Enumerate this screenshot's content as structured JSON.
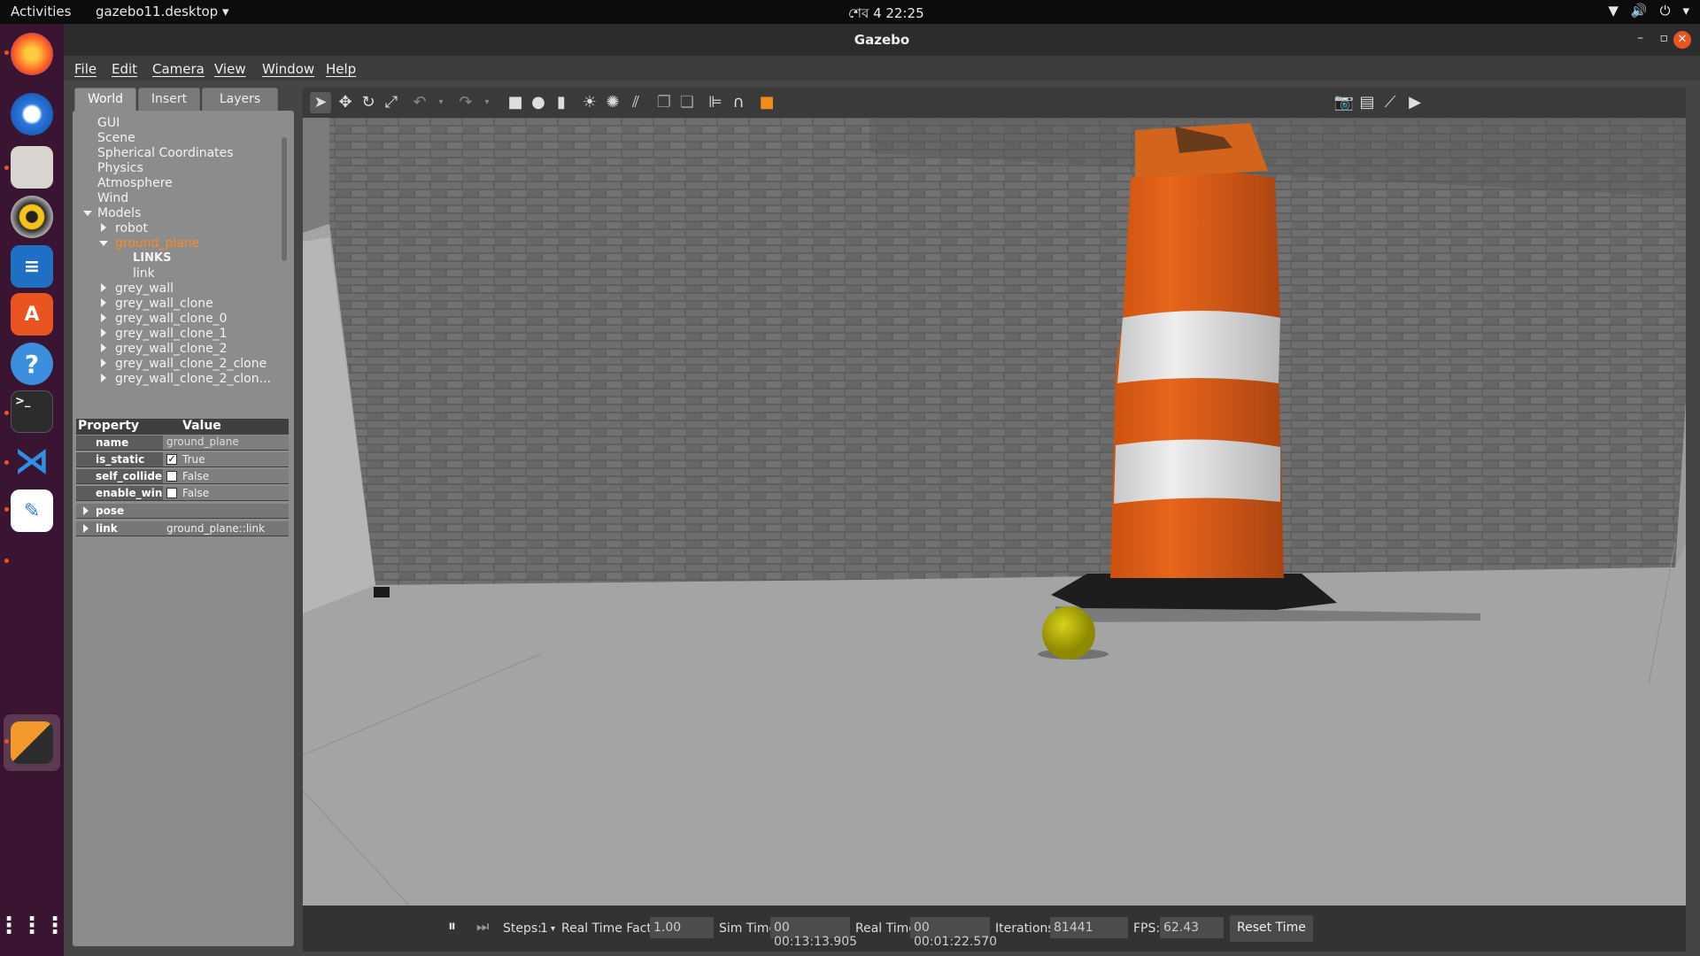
{
  "topbar": {
    "activities": "Activities",
    "app": "gazebo11.desktop ▾",
    "clock": "শেব 4  22:25"
  },
  "window": {
    "title": "Gazebo"
  },
  "menu": {
    "file": "File",
    "edit": "Edit",
    "camera": "Camera",
    "view": "View",
    "window": "Window",
    "help": "Help"
  },
  "tabs": {
    "world": "World",
    "insert": "Insert",
    "layers": "Layers"
  },
  "tree": {
    "gui": "GUI",
    "scene": "Scene",
    "spherical": "Spherical Coordinates",
    "physics": "Physics",
    "atmosphere": "Atmosphere",
    "wind": "Wind",
    "models": "Models",
    "robot": "robot",
    "ground_plane": "ground_plane",
    "links": "LINKS",
    "link": "link",
    "grey_wall": "grey_wall",
    "grey_wall_clone": "grey_wall_clone",
    "grey_wall_clone_0": "grey_wall_clone_0",
    "grey_wall_clone_1": "grey_wall_clone_1",
    "grey_wall_clone_2": "grey_wall_clone_2",
    "grey_wall_clone_2_clone": "grey_wall_clone_2_clone",
    "grey_wall_clone_2_clon": "grey_wall_clone_2_clon..."
  },
  "props": {
    "header_property": "Property",
    "header_value": "Value",
    "name_k": "name",
    "name_v": "ground_plane",
    "static_k": "is_static",
    "static_v": "True",
    "collide_k": "self_collide",
    "collide_v": "False",
    "wind_k": "enable_wind",
    "wind_v": "False",
    "pose_k": "pose",
    "link_k": "link",
    "link_v": "ground_plane::link"
  },
  "bottom": {
    "steps_label": "Steps:",
    "steps_value": "1",
    "rtf_label": "Real Time Factor:",
    "rtf_value": "1.00",
    "sim_label": "Sim Time:",
    "sim_value": "00 00:13:13.905",
    "real_label": "Real Time:",
    "real_value": "00 00:01:22.570",
    "iter_label": "Iterations:",
    "iter_value": "81441",
    "fps_label": "FPS:",
    "fps_value": "62.43",
    "reset": "Reset Time"
  },
  "colors": {
    "accent": "#e95420",
    "selected_text": "#ff8a1e",
    "dock": "#3a1531"
  }
}
